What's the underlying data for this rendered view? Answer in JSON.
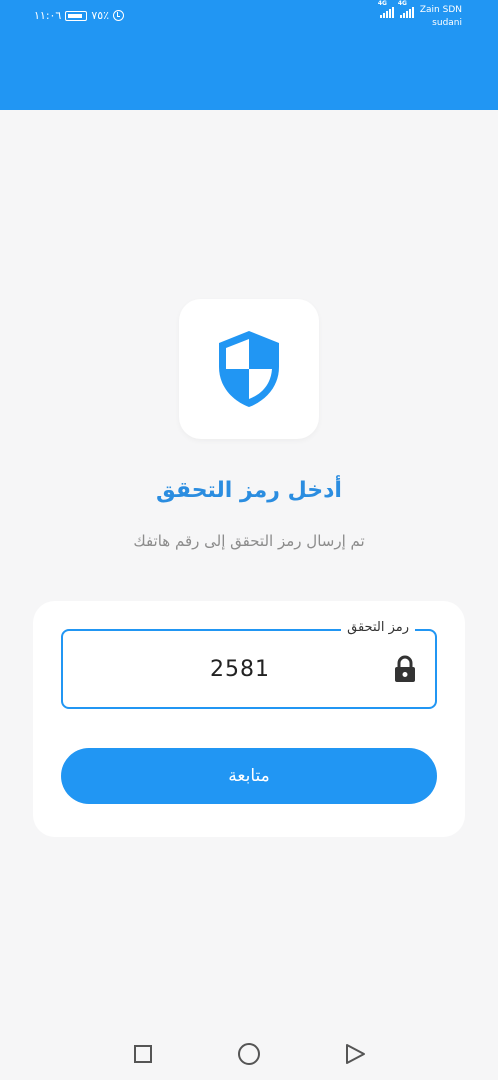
{
  "status_bar": {
    "time": "١١:٠٦",
    "percent": "٧٥٪",
    "network_1": "4G",
    "network_2": "4G",
    "carrier_1": "Zain SDN",
    "carrier_2": "sudani"
  },
  "header": {
    "color": "#2196f3"
  },
  "main": {
    "icon": "shield-icon",
    "title": "أدخل رمز التحقق",
    "subtitle": "تم إرسال رمز التحقق إلى رقم هاتفك"
  },
  "form": {
    "code_label": "رمز التحقق",
    "code_value": "2581",
    "continue_label": "متابعة"
  },
  "nav_bar": {
    "recents": "square-icon",
    "home": "circle-icon",
    "back": "triangle-back-icon"
  }
}
